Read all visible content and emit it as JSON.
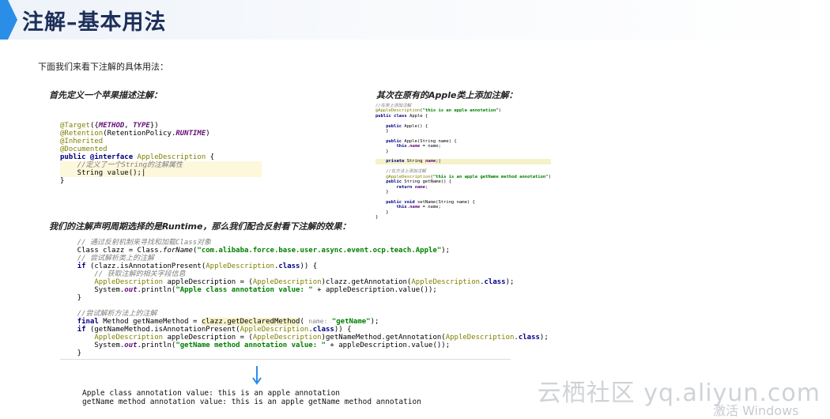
{
  "header": {
    "title": "注解–基本用法"
  },
  "intro": "下面我们来看下注解的具体用法：",
  "section1": {
    "label": "首先定义一个苹果描述注解："
  },
  "section2": {
    "label": "其次在原有的Apple类上添加注解："
  },
  "section3": {
    "label": "我们的注解声明周期选择的是Runtime，那么我们配合反射看下注解的效果："
  },
  "output": {
    "line1": "Apple class annotation value: this is an apple annotation",
    "line2": "getName method annotation value: this is an apple getName method annotation"
  },
  "watermark": "云栖社区 yq.aliyun.com",
  "watermark2": "激活 Windows",
  "colors": {
    "title": "#1d2f5a",
    "accent": "#2a8ee8"
  }
}
